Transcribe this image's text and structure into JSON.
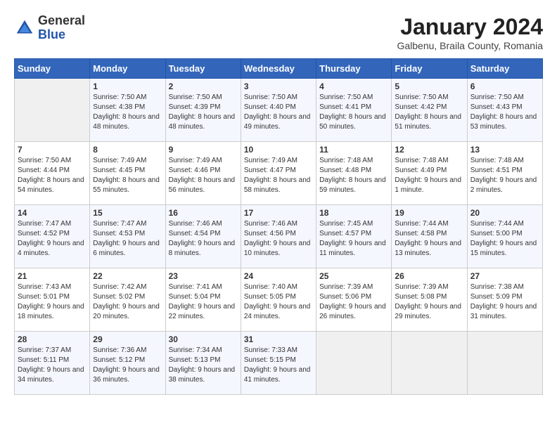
{
  "logo": {
    "general": "General",
    "blue": "Blue"
  },
  "header": {
    "month": "January 2024",
    "location": "Galbenu, Braila County, Romania"
  },
  "weekdays": [
    "Sunday",
    "Monday",
    "Tuesday",
    "Wednesday",
    "Thursday",
    "Friday",
    "Saturday"
  ],
  "weeks": [
    [
      {
        "day": "",
        "sunrise": "",
        "sunset": "",
        "daylight": ""
      },
      {
        "day": "1",
        "sunrise": "Sunrise: 7:50 AM",
        "sunset": "Sunset: 4:38 PM",
        "daylight": "Daylight: 8 hours and 48 minutes."
      },
      {
        "day": "2",
        "sunrise": "Sunrise: 7:50 AM",
        "sunset": "Sunset: 4:39 PM",
        "daylight": "Daylight: 8 hours and 48 minutes."
      },
      {
        "day": "3",
        "sunrise": "Sunrise: 7:50 AM",
        "sunset": "Sunset: 4:40 PM",
        "daylight": "Daylight: 8 hours and 49 minutes."
      },
      {
        "day": "4",
        "sunrise": "Sunrise: 7:50 AM",
        "sunset": "Sunset: 4:41 PM",
        "daylight": "Daylight: 8 hours and 50 minutes."
      },
      {
        "day": "5",
        "sunrise": "Sunrise: 7:50 AM",
        "sunset": "Sunset: 4:42 PM",
        "daylight": "Daylight: 8 hours and 51 minutes."
      },
      {
        "day": "6",
        "sunrise": "Sunrise: 7:50 AM",
        "sunset": "Sunset: 4:43 PM",
        "daylight": "Daylight: 8 hours and 53 minutes."
      }
    ],
    [
      {
        "day": "7",
        "sunrise": "Sunrise: 7:50 AM",
        "sunset": "Sunset: 4:44 PM",
        "daylight": "Daylight: 8 hours and 54 minutes."
      },
      {
        "day": "8",
        "sunrise": "Sunrise: 7:49 AM",
        "sunset": "Sunset: 4:45 PM",
        "daylight": "Daylight: 8 hours and 55 minutes."
      },
      {
        "day": "9",
        "sunrise": "Sunrise: 7:49 AM",
        "sunset": "Sunset: 4:46 PM",
        "daylight": "Daylight: 8 hours and 56 minutes."
      },
      {
        "day": "10",
        "sunrise": "Sunrise: 7:49 AM",
        "sunset": "Sunset: 4:47 PM",
        "daylight": "Daylight: 8 hours and 58 minutes."
      },
      {
        "day": "11",
        "sunrise": "Sunrise: 7:48 AM",
        "sunset": "Sunset: 4:48 PM",
        "daylight": "Daylight: 8 hours and 59 minutes."
      },
      {
        "day": "12",
        "sunrise": "Sunrise: 7:48 AM",
        "sunset": "Sunset: 4:49 PM",
        "daylight": "Daylight: 9 hours and 1 minute."
      },
      {
        "day": "13",
        "sunrise": "Sunrise: 7:48 AM",
        "sunset": "Sunset: 4:51 PM",
        "daylight": "Daylight: 9 hours and 2 minutes."
      }
    ],
    [
      {
        "day": "14",
        "sunrise": "Sunrise: 7:47 AM",
        "sunset": "Sunset: 4:52 PM",
        "daylight": "Daylight: 9 hours and 4 minutes."
      },
      {
        "day": "15",
        "sunrise": "Sunrise: 7:47 AM",
        "sunset": "Sunset: 4:53 PM",
        "daylight": "Daylight: 9 hours and 6 minutes."
      },
      {
        "day": "16",
        "sunrise": "Sunrise: 7:46 AM",
        "sunset": "Sunset: 4:54 PM",
        "daylight": "Daylight: 9 hours and 8 minutes."
      },
      {
        "day": "17",
        "sunrise": "Sunrise: 7:46 AM",
        "sunset": "Sunset: 4:56 PM",
        "daylight": "Daylight: 9 hours and 10 minutes."
      },
      {
        "day": "18",
        "sunrise": "Sunrise: 7:45 AM",
        "sunset": "Sunset: 4:57 PM",
        "daylight": "Daylight: 9 hours and 11 minutes."
      },
      {
        "day": "19",
        "sunrise": "Sunrise: 7:44 AM",
        "sunset": "Sunset: 4:58 PM",
        "daylight": "Daylight: 9 hours and 13 minutes."
      },
      {
        "day": "20",
        "sunrise": "Sunrise: 7:44 AM",
        "sunset": "Sunset: 5:00 PM",
        "daylight": "Daylight: 9 hours and 15 minutes."
      }
    ],
    [
      {
        "day": "21",
        "sunrise": "Sunrise: 7:43 AM",
        "sunset": "Sunset: 5:01 PM",
        "daylight": "Daylight: 9 hours and 18 minutes."
      },
      {
        "day": "22",
        "sunrise": "Sunrise: 7:42 AM",
        "sunset": "Sunset: 5:02 PM",
        "daylight": "Daylight: 9 hours and 20 minutes."
      },
      {
        "day": "23",
        "sunrise": "Sunrise: 7:41 AM",
        "sunset": "Sunset: 5:04 PM",
        "daylight": "Daylight: 9 hours and 22 minutes."
      },
      {
        "day": "24",
        "sunrise": "Sunrise: 7:40 AM",
        "sunset": "Sunset: 5:05 PM",
        "daylight": "Daylight: 9 hours and 24 minutes."
      },
      {
        "day": "25",
        "sunrise": "Sunrise: 7:39 AM",
        "sunset": "Sunset: 5:06 PM",
        "daylight": "Daylight: 9 hours and 26 minutes."
      },
      {
        "day": "26",
        "sunrise": "Sunrise: 7:39 AM",
        "sunset": "Sunset: 5:08 PM",
        "daylight": "Daylight: 9 hours and 29 minutes."
      },
      {
        "day": "27",
        "sunrise": "Sunrise: 7:38 AM",
        "sunset": "Sunset: 5:09 PM",
        "daylight": "Daylight: 9 hours and 31 minutes."
      }
    ],
    [
      {
        "day": "28",
        "sunrise": "Sunrise: 7:37 AM",
        "sunset": "Sunset: 5:11 PM",
        "daylight": "Daylight: 9 hours and 34 minutes."
      },
      {
        "day": "29",
        "sunrise": "Sunrise: 7:36 AM",
        "sunset": "Sunset: 5:12 PM",
        "daylight": "Daylight: 9 hours and 36 minutes."
      },
      {
        "day": "30",
        "sunrise": "Sunrise: 7:34 AM",
        "sunset": "Sunset: 5:13 PM",
        "daylight": "Daylight: 9 hours and 38 minutes."
      },
      {
        "day": "31",
        "sunrise": "Sunrise: 7:33 AM",
        "sunset": "Sunset: 5:15 PM",
        "daylight": "Daylight: 9 hours and 41 minutes."
      },
      {
        "day": "",
        "sunrise": "",
        "sunset": "",
        "daylight": ""
      },
      {
        "day": "",
        "sunrise": "",
        "sunset": "",
        "daylight": ""
      },
      {
        "day": "",
        "sunrise": "",
        "sunset": "",
        "daylight": ""
      }
    ]
  ]
}
